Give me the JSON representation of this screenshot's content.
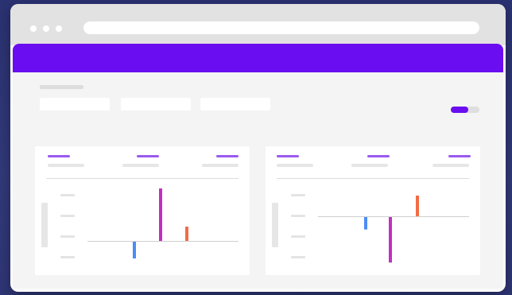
{
  "window": {
    "title": "",
    "url": ""
  },
  "toolbar": {
    "tabs": [
      "",
      "",
      ""
    ],
    "toggle_on": true
  },
  "colors": {
    "accent": "#6a0df0",
    "bar_blue": "#4b8df5",
    "bar_magenta": "#c230c0",
    "bar_orange": "#f36c45"
  },
  "chart_data": [
    {
      "type": "bar",
      "categories": [
        "",
        "",
        ""
      ],
      "values": [
        -7,
        22,
        6
      ],
      "colors": [
        "#4b8df5",
        "#c230c0",
        "#f36c45"
      ],
      "ylim": [
        -10,
        25
      ],
      "title": "",
      "xlabel": "",
      "ylabel": ""
    },
    {
      "type": "bar",
      "categories": [
        "",
        "",
        ""
      ],
      "values": [
        -6,
        -22,
        10
      ],
      "colors": [
        "#4b8df5",
        "#c230c0",
        "#f36c45"
      ],
      "ylim": [
        -22,
        12
      ],
      "title": "",
      "xlabel": "",
      "ylabel": ""
    }
  ]
}
